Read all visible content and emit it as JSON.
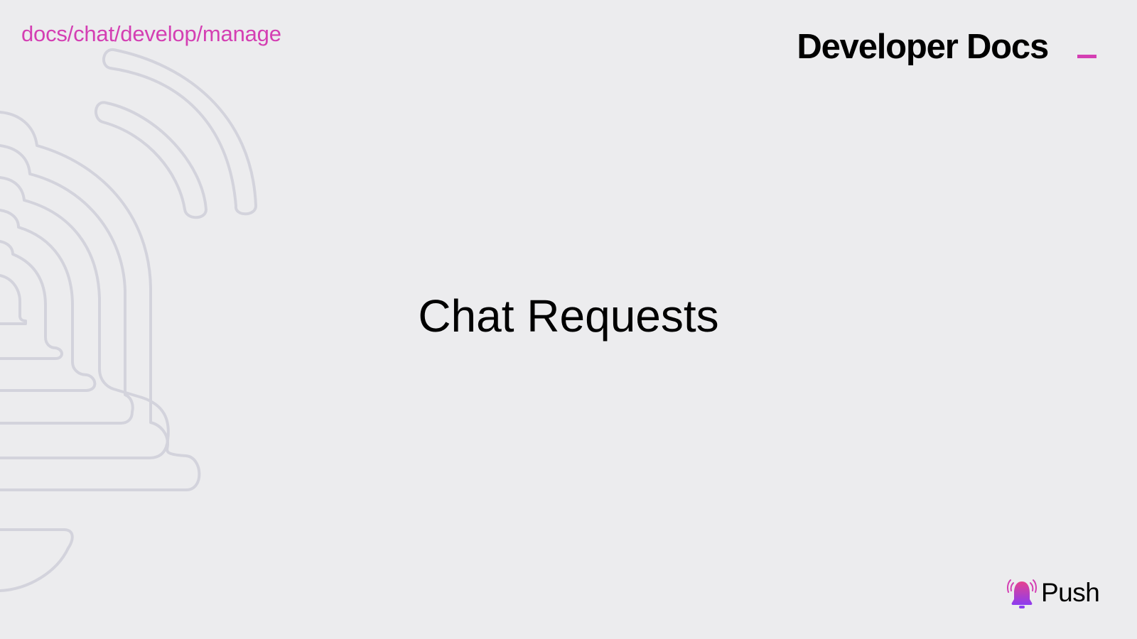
{
  "header": {
    "breadcrumb": "docs/chat/develop/manage",
    "brand_title": "Developer Docs"
  },
  "main": {
    "title": "Chat Requests"
  },
  "footer": {
    "logo_text": "Push",
    "logo_icon": "bell-icon"
  },
  "colors": {
    "background": "#ececee",
    "accent": "#d43fb3",
    "outline_art": "#d3d3dc",
    "text": "#000000"
  }
}
